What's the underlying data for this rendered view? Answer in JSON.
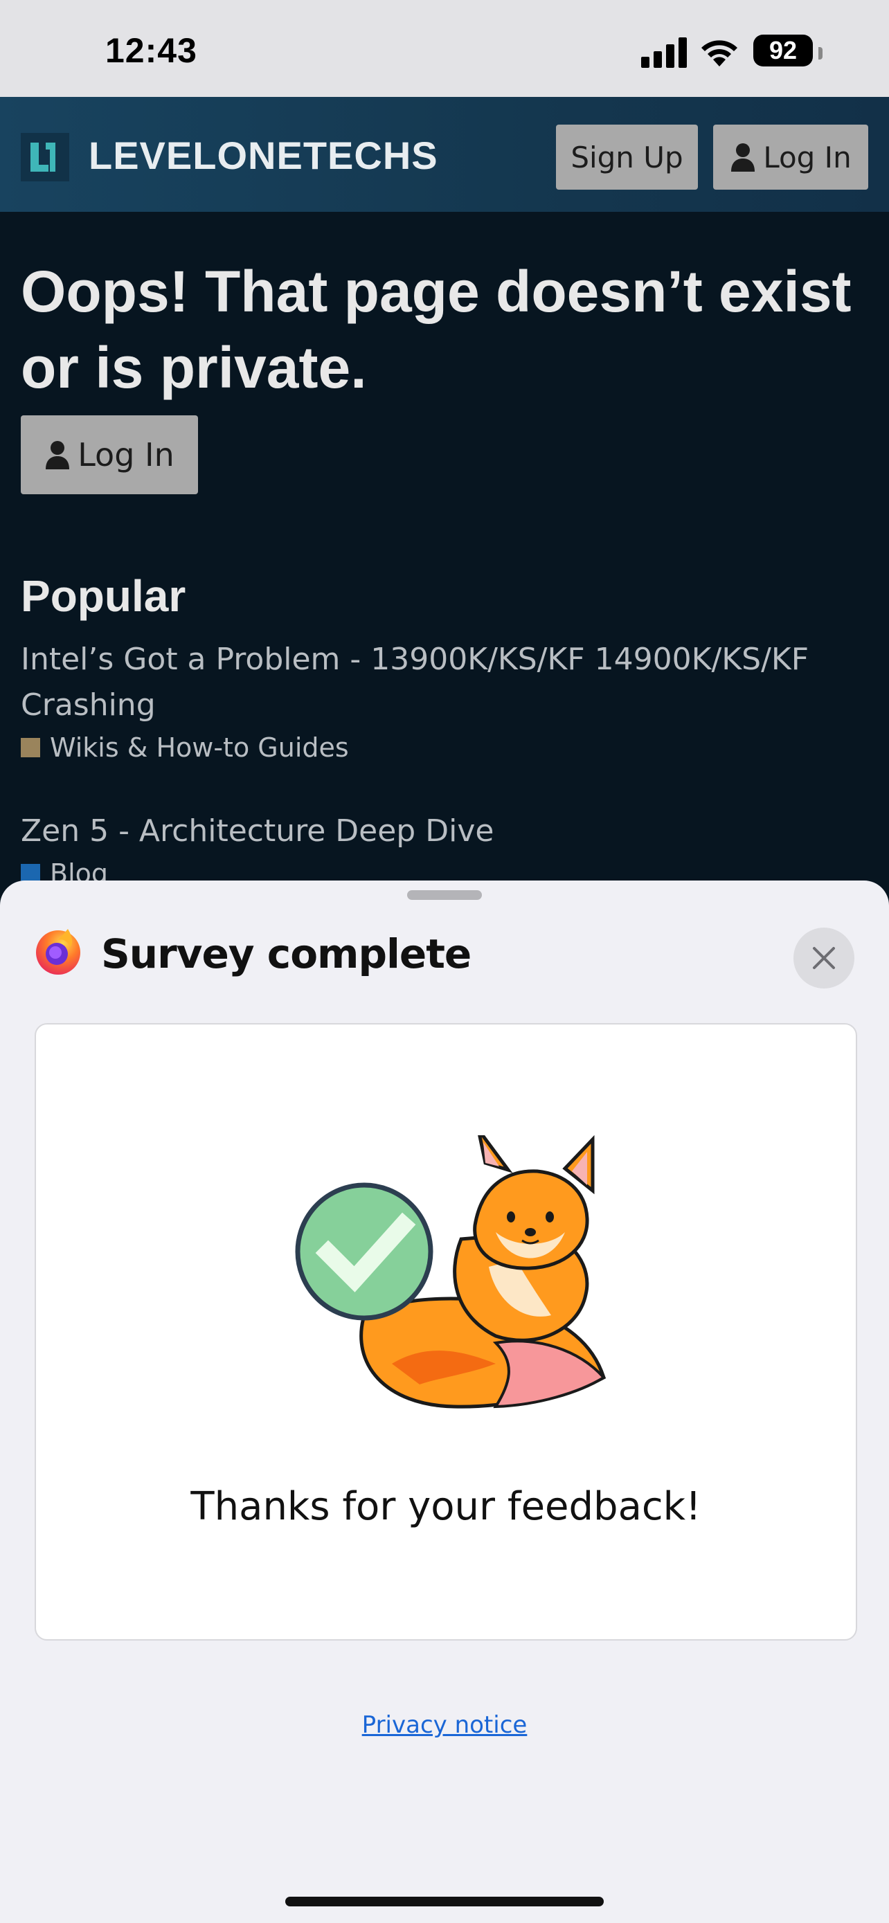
{
  "status_bar": {
    "time": "12:43",
    "battery": "92"
  },
  "site": {
    "brand": "LEVELONETECHS",
    "signup_label": "Sign Up",
    "login_label": "Log In"
  },
  "page": {
    "heading": "Oops! That page doesn’t exist or is private.",
    "login_label": "Log In",
    "popular_title": "Popular",
    "topics": [
      {
        "title": "Intel’s Got a Problem - 13900K/KS/KF 14900K/KS/KF Crashing",
        "category": "Wikis & How-to Guides",
        "category_color": "#9a845c"
      },
      {
        "title": "Zen 5 - Architecture Deep Dive",
        "category": "Blog",
        "category_color": "#1b67b0"
      }
    ]
  },
  "sheet": {
    "title": "Survey complete",
    "message": "Thanks for your feedback!",
    "privacy_link": "Privacy notice"
  }
}
